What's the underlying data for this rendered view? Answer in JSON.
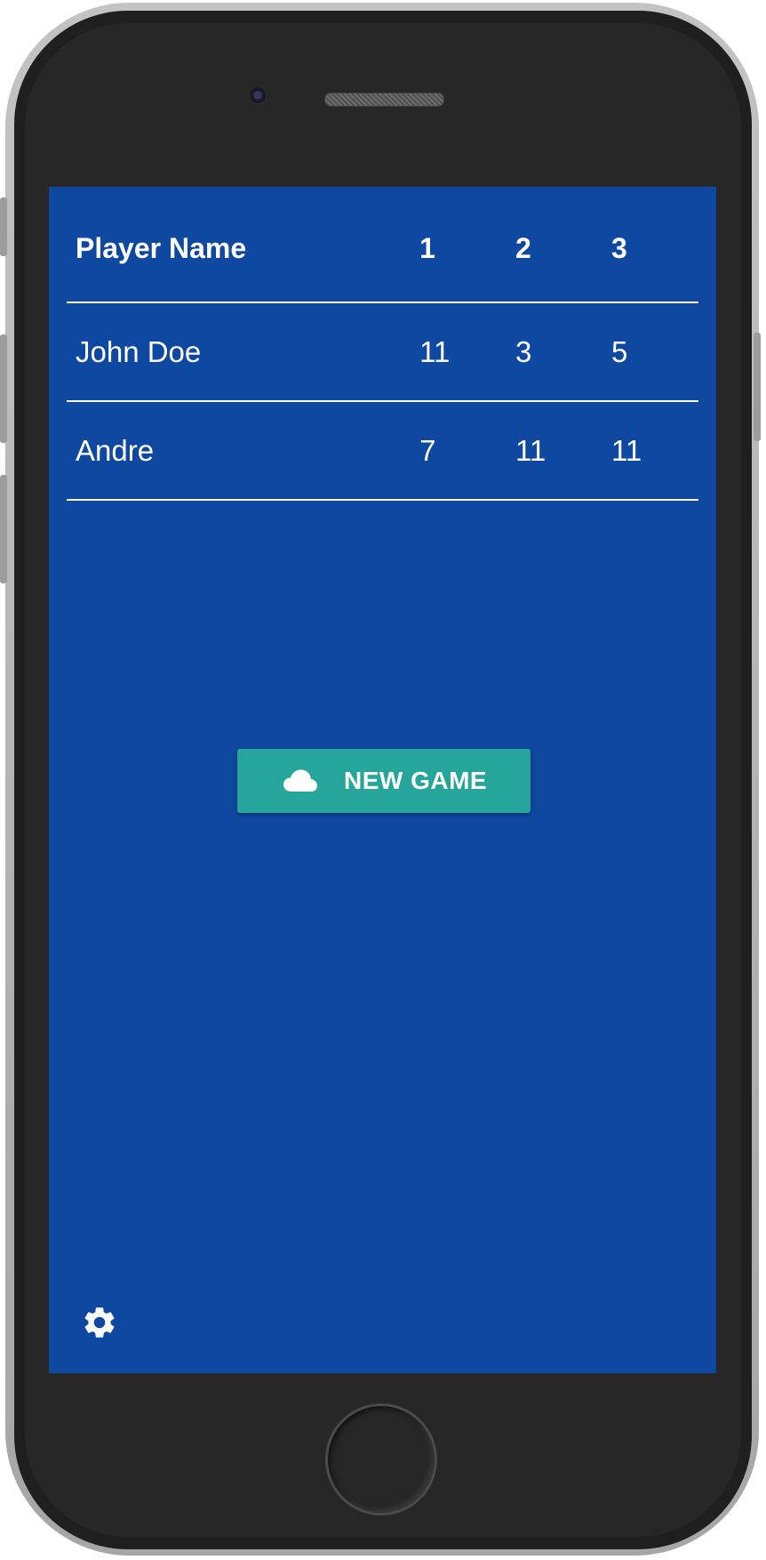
{
  "scoreboard": {
    "headers": {
      "name": "Player Name",
      "game1": "1",
      "game2": "2",
      "game3": "3"
    },
    "rows": [
      {
        "name": "John Doe",
        "scores": [
          "11",
          "3",
          "5"
        ]
      },
      {
        "name": "Andre",
        "scores": [
          "7",
          "11",
          "11"
        ]
      }
    ]
  },
  "actions": {
    "new_game_label": "NEW GAME",
    "new_game_icon": "cloud-icon",
    "settings_icon": "gear-icon"
  },
  "theme": {
    "background": "#0e48a1",
    "button": "#26a69a",
    "text": "#ffffff"
  }
}
